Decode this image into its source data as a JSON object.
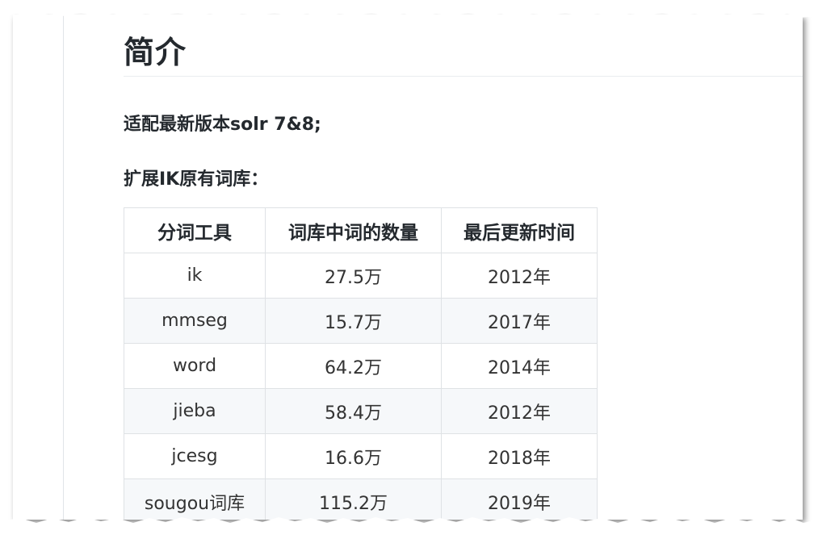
{
  "heading": "简介",
  "paragraphs": {
    "p1": "适配最新版本solr 7&8;",
    "p2": "扩展IK原有词库："
  },
  "table": {
    "headers": [
      "分词工具",
      "词库中词的数量",
      "最后更新时间"
    ],
    "rows": [
      [
        "ik",
        "27.5万",
        "2012年"
      ],
      [
        "mmseg",
        "15.7万",
        "2017年"
      ],
      [
        "word",
        "64.2万",
        "2014年"
      ],
      [
        "jieba",
        "58.4万",
        "2012年"
      ],
      [
        "jcesg",
        "16.6万",
        "2018年"
      ],
      [
        "sougou词库",
        "115.2万",
        "2019年"
      ]
    ]
  }
}
